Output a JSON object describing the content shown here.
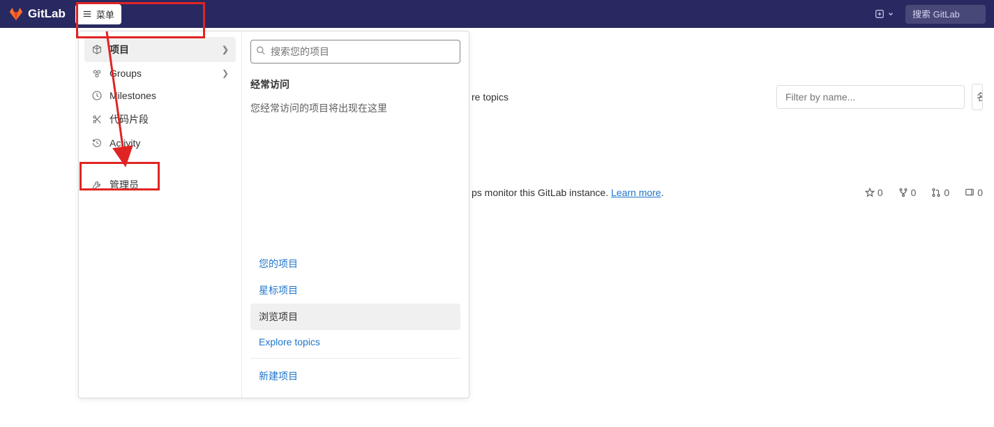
{
  "topbar": {
    "brand": "GitLab",
    "menu_label": "菜单",
    "search_placeholder": "搜索 GitLab"
  },
  "menu_left": {
    "items": [
      {
        "label": "项目",
        "icon": "project",
        "has_sub": true,
        "active": true
      },
      {
        "label": "Groups",
        "icon": "group",
        "has_sub": true
      },
      {
        "label": "Milestones",
        "icon": "clock"
      },
      {
        "label": "代码片段",
        "icon": "scissors"
      },
      {
        "label": "Activity",
        "icon": "history"
      }
    ],
    "admin": {
      "label": "管理员",
      "icon": "wrench"
    }
  },
  "menu_right": {
    "project_search_placeholder": "搜索您的项目",
    "freq_label": "经常访问",
    "freq_desc": "您经常访问的项目将出现在这里",
    "nav_links": {
      "your_projects": "您的项目",
      "starred": "星标项目",
      "browse": "浏览项目",
      "explore_topics": "Explore topics",
      "new_project": "新建项目"
    }
  },
  "page_bg": {
    "topics_text": "re topics",
    "filter_placeholder": "Filter by name...",
    "sort_label": "名",
    "monitor_text_a": "ps monitor this GitLab instance. ",
    "monitor_link": "Learn more",
    "monitor_text_b": ".",
    "stats": {
      "stars": "0",
      "forks": "0",
      "mrs": "0",
      "issues": "0"
    }
  }
}
